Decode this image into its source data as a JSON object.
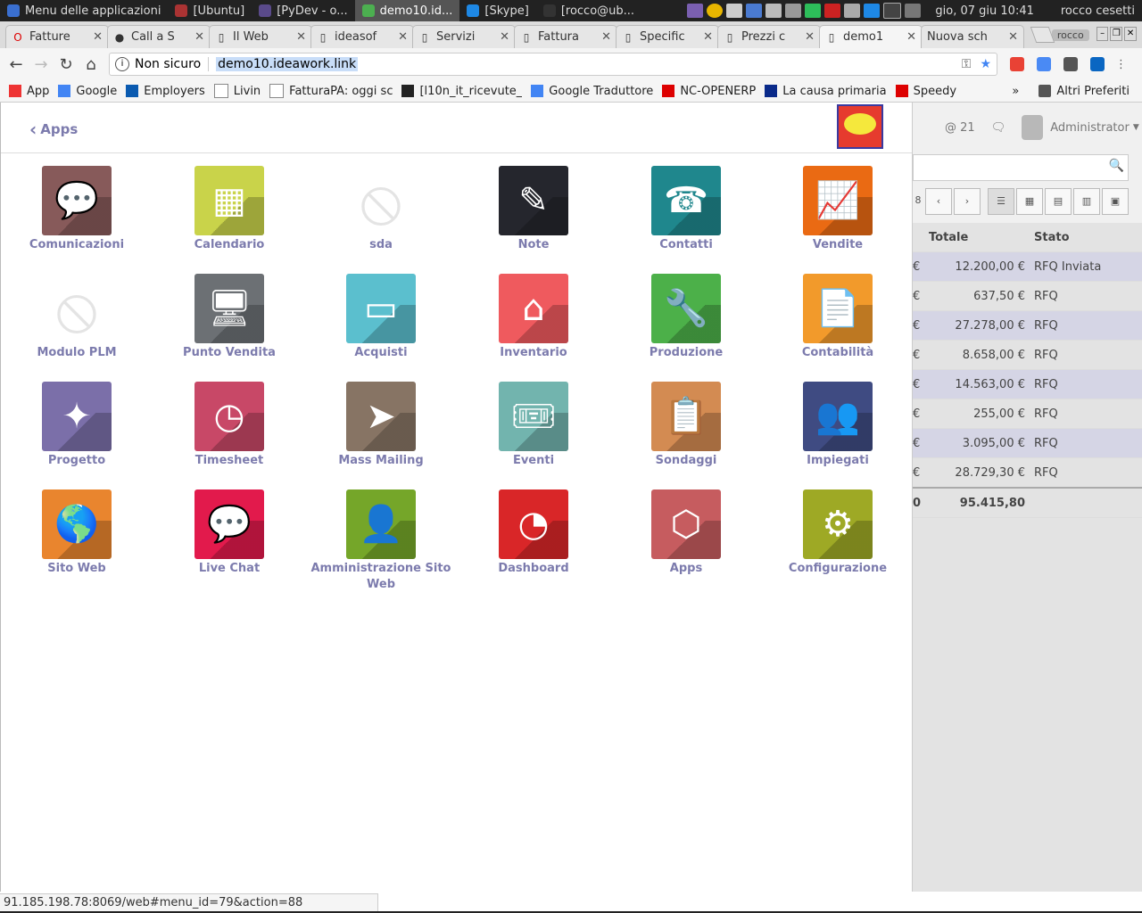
{
  "os_panel": {
    "apps": [
      {
        "label": "Menu delle applicazioni",
        "color": "#3a6fd0",
        "active": false
      },
      {
        "label": "[Ubuntu]",
        "color": "#a33",
        "active": false
      },
      {
        "label": "[PyDev - o...",
        "color": "#5a4a8a",
        "active": false
      },
      {
        "label": "demo10.id...",
        "color": "#4caf50",
        "active": true
      },
      {
        "label": "[Skype]",
        "color": "#1e88e5",
        "active": false
      },
      {
        "label": "[rocco@ub...",
        "color": "#333",
        "active": false
      }
    ],
    "clock": "gio, 07 giu  10:41",
    "user": "rocco cesetti"
  },
  "tabs": [
    {
      "label": "Fatture",
      "icon": "opera-icon",
      "active": false
    },
    {
      "label": "Call a S",
      "icon": "github-icon",
      "active": false
    },
    {
      "label": "Il Web",
      "icon": "page-icon",
      "active": false
    },
    {
      "label": "ideasof",
      "icon": "page-icon",
      "active": false
    },
    {
      "label": "Servizi",
      "icon": "site-icon",
      "active": false
    },
    {
      "label": "Fattura",
      "icon": "site-icon",
      "active": false
    },
    {
      "label": "Specific",
      "icon": "page-icon",
      "active": false
    },
    {
      "label": "Prezzi c",
      "icon": "page-icon",
      "active": false
    },
    {
      "label": "demo1",
      "icon": "page-icon",
      "active": true
    },
    {
      "label": "Nuova sch",
      "icon": "none",
      "active": false
    }
  ],
  "profile_label": "rocco",
  "address": {
    "security": "Non sicuro",
    "url": "demo10.ideawork.link"
  },
  "bookmarks": [
    {
      "label": "App",
      "color": "#e33"
    },
    {
      "label": "Google",
      "color": "#4285f4"
    },
    {
      "label": "Employers",
      "color": "#0a5ab0"
    },
    {
      "label": "Livin",
      "color": "#ffffff"
    },
    {
      "label": "FatturaPA: oggi sc",
      "color": "#ffffff"
    },
    {
      "label": "[l10n_it_ricevute_",
      "color": "#222"
    },
    {
      "label": "Google Traduttore",
      "color": "#4285f4"
    },
    {
      "label": "NC-OPENERP",
      "color": "#d00"
    },
    {
      "label": "La causa primaria",
      "color": "#0a2a8a"
    },
    {
      "label": "Speedy",
      "color": "#d00"
    }
  ],
  "bookmarks_more": "»",
  "other_bookmarks": "Altri Preferiti",
  "panel": {
    "back_label": "Apps"
  },
  "apps": [
    {
      "label": "Comunicazioni",
      "color": "#875a5a",
      "icon": "chat-bubble-icon",
      "glyph": "💬",
      "placeholder": false
    },
    {
      "label": "Calendario",
      "color": "#c9d34a",
      "icon": "calendar-icon",
      "glyph": "▦",
      "placeholder": false
    },
    {
      "label": "sda",
      "color": "#ffffff",
      "icon": "no-image-icon",
      "glyph": "⦸",
      "placeholder": true
    },
    {
      "label": "Note",
      "color": "#25262d",
      "icon": "note-edit-icon",
      "glyph": "✎",
      "placeholder": false
    },
    {
      "label": "Contatti",
      "color": "#1f878d",
      "icon": "contact-icon",
      "glyph": "☎",
      "placeholder": false
    },
    {
      "label": "Vendite",
      "color": "#ea6a13",
      "icon": "trend-chart-icon",
      "glyph": "📈",
      "placeholder": false
    },
    {
      "label": "Modulo PLM",
      "color": "#ffffff",
      "icon": "no-image-icon",
      "glyph": "⦸",
      "placeholder": true
    },
    {
      "label": "Punto Vendita",
      "color": "#6c7074",
      "icon": "monitor-icon",
      "glyph": "🖥",
      "placeholder": false
    },
    {
      "label": "Acquisti",
      "color": "#5bbfce",
      "icon": "credit-card-icon",
      "glyph": "▭",
      "placeholder": false
    },
    {
      "label": "Inventario",
      "color": "#ef5a5e",
      "icon": "warehouse-icon",
      "glyph": "⌂",
      "placeholder": false
    },
    {
      "label": "Produzione",
      "color": "#4cb049",
      "icon": "wrench-icon",
      "glyph": "🔧",
      "placeholder": false
    },
    {
      "label": "Contabilità",
      "color": "#f29a2b",
      "icon": "document-icon",
      "glyph": "📄",
      "placeholder": false
    },
    {
      "label": "Progetto",
      "color": "#7b6fa9",
      "icon": "puzzle-icon",
      "glyph": "✦",
      "placeholder": false
    },
    {
      "label": "Timesheet",
      "color": "#c84867",
      "icon": "clock-icon",
      "glyph": "◷",
      "placeholder": false
    },
    {
      "label": "Mass Mailing",
      "color": "#877464",
      "icon": "paper-plane-icon",
      "glyph": "➤",
      "placeholder": false
    },
    {
      "label": "Eventi",
      "color": "#72b4ae",
      "icon": "ticket-icon",
      "glyph": "🎟",
      "placeholder": false
    },
    {
      "label": "Sondaggi",
      "color": "#d38b52",
      "icon": "clipboard-icon",
      "glyph": "📋",
      "placeholder": false
    },
    {
      "label": "Impiegati",
      "color": "#3f4b82",
      "icon": "people-icon",
      "glyph": "👥",
      "placeholder": false
    },
    {
      "label": "Sito Web",
      "color": "#e9852e",
      "icon": "globe-icon",
      "glyph": "🌎",
      "placeholder": false
    },
    {
      "label": "Live Chat",
      "color": "#e21a4c",
      "icon": "chat-bubbles-icon",
      "glyph": "💬",
      "placeholder": false
    },
    {
      "label": "Amministrazione Sito Web",
      "color": "#75a629",
      "icon": "user-gear-icon",
      "glyph": "👤",
      "placeholder": false
    },
    {
      "label": "Dashboard",
      "color": "#d92628",
      "icon": "gauge-icon",
      "glyph": "◔",
      "placeholder": false
    },
    {
      "label": "Apps",
      "color": "#c65c5f",
      "icon": "cubes-icon",
      "glyph": "⬡",
      "placeholder": false
    },
    {
      "label": "Configurazione",
      "color": "#9ea925",
      "icon": "gear-icon",
      "glyph": "⚙",
      "placeholder": false
    }
  ],
  "background_app": {
    "mentions": "@ 21",
    "user": "Administrator",
    "pager_count": "8",
    "columns": [
      "Totale",
      "Stato"
    ],
    "rows": [
      {
        "prefix": "€",
        "totale": "12.200,00 €",
        "stato": "RFQ Inviata"
      },
      {
        "prefix": "€",
        "totale": "637,50 €",
        "stato": "RFQ"
      },
      {
        "prefix": "€",
        "totale": "27.278,00 €",
        "stato": "RFQ"
      },
      {
        "prefix": "€",
        "totale": "8.658,00 €",
        "stato": "RFQ"
      },
      {
        "prefix": "€",
        "totale": "14.563,00 €",
        "stato": "RFQ"
      },
      {
        "prefix": "€",
        "totale": "255,00 €",
        "stato": "RFQ"
      },
      {
        "prefix": "€",
        "totale": "3.095,00 €",
        "stato": "RFQ"
      },
      {
        "prefix": "€",
        "totale": "28.729,30 €",
        "stato": "RFQ"
      }
    ],
    "total_prefix": "0",
    "total": "95.415,80"
  },
  "statusbar": "91.185.198.78:8069/web#menu_id=79&action=88"
}
